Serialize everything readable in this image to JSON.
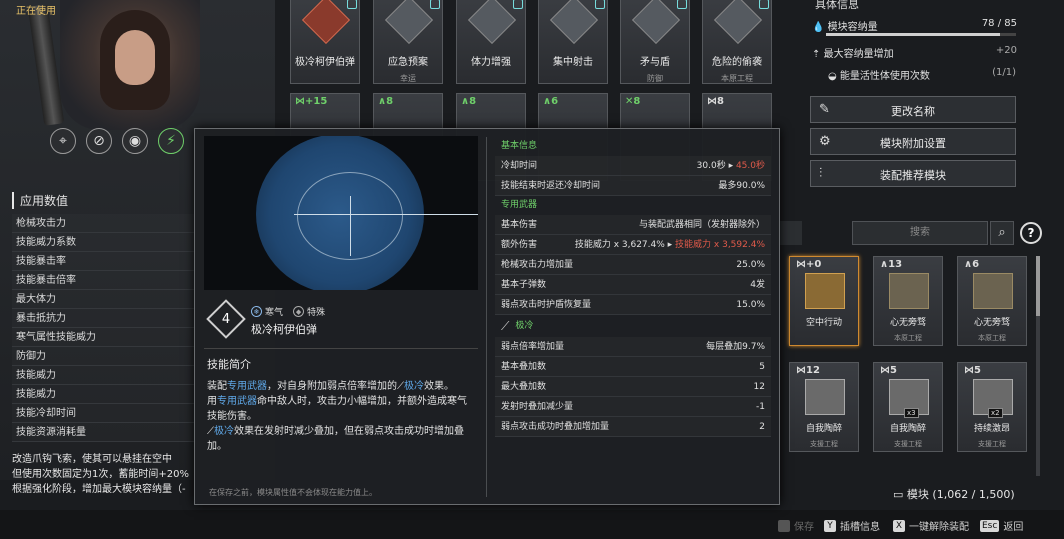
{
  "status": {
    "in_use": "正在使用"
  },
  "mod_icons": [
    "scope-mod-icon",
    "crossed-mod-icon",
    "drone-mod-icon",
    "active-mod-icon"
  ],
  "stats": {
    "title": "应用数值",
    "items": [
      "枪械攻击力",
      "技能威力系数",
      "技能暴击率",
      "技能暴击倍率",
      "最大体力",
      "暴击抵抗力",
      "寒气属性技能威力",
      "防御力",
      "技能威力",
      "技能威力",
      "技能冷却时间",
      "技能资源消耗量"
    ]
  },
  "left_description": [
    "改造爪钩飞索，使其可以悬挂在空中",
    "但使用次数固定为1次，蓄能时间+20%",
    "根据强化阶段，增加最大模块容纳量（-"
  ],
  "top_modules": [
    {
      "name": "极冷柯伊伯弹",
      "sub": ""
    },
    {
      "name": "应急预案",
      "sub": "幸运"
    },
    {
      "name": "体力增强",
      "sub": ""
    },
    {
      "name": "集中射击",
      "sub": ""
    },
    {
      "name": "矛与盾",
      "sub": "防御"
    },
    {
      "name": "危险的偷袭",
      "sub": "本原工程"
    }
  ],
  "top_modules_row2": [
    {
      "cap": "+15"
    },
    {
      "cap": "8"
    },
    {
      "cap": "8"
    },
    {
      "cap": "6"
    },
    {
      "cap": "8"
    },
    {
      "cap": "8"
    }
  ],
  "info_panel": {
    "title": "具体信息",
    "capacity_label": "模块容纳量",
    "capacity_value": "78 / 85",
    "capacity_fill": 0.918,
    "max_cap_label": "最大容纳量增加",
    "max_cap_value": "+20",
    "energy_label": "能量活性体使用次数",
    "energy_value": "(1/1)",
    "buttons": [
      "更改名称",
      "模块附加设置",
      "装配推荐模块"
    ]
  },
  "search": {
    "placeholder": "搜索",
    "help": "?"
  },
  "inventory": [
    {
      "cap": "+0",
      "name": "空中行动",
      "sub": "",
      "count": ""
    },
    {
      "cap": "13",
      "name": "心无旁骛",
      "sub": "本原工程",
      "count": ""
    },
    {
      "cap": "6",
      "name": "心无旁骛",
      "sub": "本原工程",
      "count": ""
    },
    {
      "cap": "12",
      "name": "自我陶醉",
      "sub": "支援工程",
      "count": ""
    },
    {
      "cap": "5",
      "name": "自我陶醉",
      "sub": "支援工程",
      "count": "x3"
    },
    {
      "cap": "5",
      "name": "持续激昂",
      "sub": "支援工程",
      "count": "x2"
    }
  ],
  "module_count": {
    "label": "模块",
    "value": "(1,062 / 1,500)"
  },
  "bottom_bar": {
    "save": "保存",
    "slot_info_key": "Y",
    "slot_info": "插槽信息",
    "unequip_key": "X",
    "unequip": "一键解除装配",
    "back_key": "Esc",
    "back": "返回"
  },
  "tooltip": {
    "level": "4",
    "tags": [
      "寒气",
      "特殊"
    ],
    "name": "极冷柯伊伯弹",
    "intro_title": "技能简介",
    "intro": {
      "p1a": "装配",
      "p1b": "专用武器",
      "p1c": "，对自身附加弱点倍率增加的",
      "p1d": "极冷",
      "p1e": "效果。",
      "p2a": "用",
      "p2b": "专用武器",
      "p2c": "命中敌人时，攻击力小幅增加，并额外造成寒气技能伤害。",
      "p3a": "极冷",
      "p3b": "效果在发射时减少叠加，但在弱点攻击成功时增加叠加。"
    },
    "footnote": "在保存之前，模块属性值不会体现在能力值上。",
    "basic_title": "基本信息",
    "cooldown_label": "冷却时间",
    "cooldown_value": "30.0秒",
    "cooldown_new": "45.0秒",
    "refund_label": "技能结束时返还冷却时间",
    "refund_value": "最多90.0%",
    "weapon_title": "专用武器",
    "base_damage_label": "基本伤害",
    "base_damage_value": "与装配武器相同（发射器除外）",
    "extra_damage_label": "额外伤害",
    "extra_damage_value": "技能威力 x 3,627.4%",
    "extra_damage_new": "技能威力 x 3,592.4%",
    "atk_inc_label": "枪械攻击力增加量",
    "atk_inc_value": "25.0%",
    "ammo_label": "基本子弹数",
    "ammo_value": "4发",
    "shield_label": "弱点攻击时护盾恢复量",
    "shield_value": "15.0%",
    "cold_title": "极冷",
    "weak_label": "弱点倍率增加量",
    "weak_value": "每层叠加9.7%",
    "stack_label": "基本叠加数",
    "stack_value": "5",
    "max_stack_label": "最大叠加数",
    "max_stack_value": "12",
    "fire_dec_label": "发射时叠加减少量",
    "fire_dec_value": "-1",
    "weak_inc_label": "弱点攻击成功时叠加增加量",
    "weak_inc_value": "2"
  },
  "colors": {
    "accent_green": "#6fd06a",
    "warning_red": "#e05a4a",
    "link_blue": "#5fa8e8",
    "gold": "#e8c268"
  }
}
